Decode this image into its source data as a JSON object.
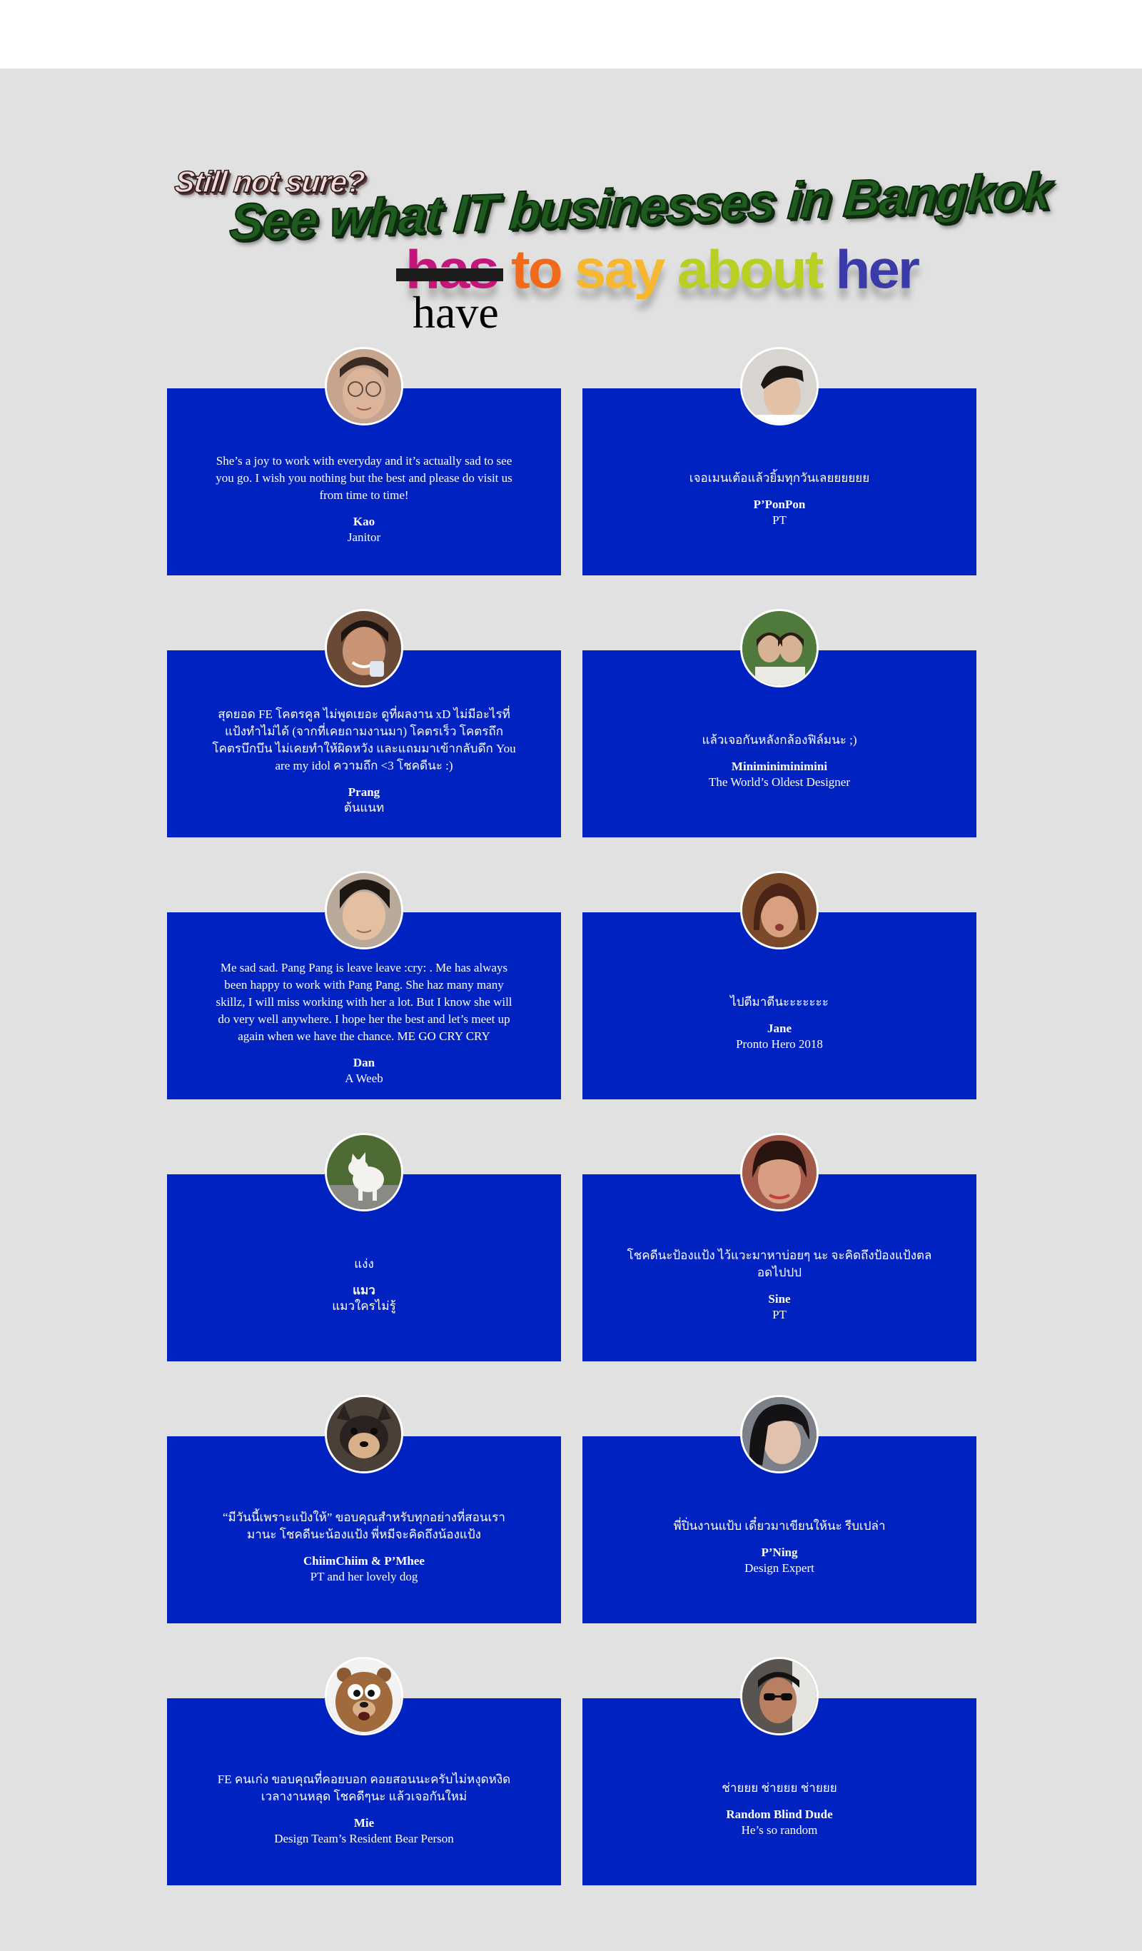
{
  "heading": {
    "still_not_sure": "Still not sure?",
    "see_what": "See what IT businesses in Bangkok",
    "has": "has",
    "to": "to",
    "say": "say",
    "about": "about",
    "her": "her",
    "have": "have"
  },
  "testimonials": [
    {
      "quote": "She’s a joy to work with everyday and it’s actually sad to see you go. I wish you nothing but the best and please do visit us from time to time!",
      "name": "Kao",
      "role": "Janitor",
      "avatar_icon": "person-photo-glasses"
    },
    {
      "quote": "เจอเมนเต้อแล้วยิ้มทุกวันเลยยยยยย",
      "name": "P’PonPon",
      "role": "PT",
      "avatar_icon": "person-photo"
    },
    {
      "quote": "สุดยอด FE โคตรคูล ไม่พูดเยอะ ดูที่ผลงาน xD ไม่มีอะไรที่แป้งทำไม่ได้ (จากที่เคยถามงานมา) โคตรเร็ว โคตรถึก โคตรบึกบึน ไม่เคยทำให้ผิดหวัง และแถมมาเข้ากลับดึก You are my idol ความถึก <3 โชคดีนะ :)",
      "name": "Prang",
      "role": "ต้นแนท",
      "avatar_icon": "person-photo-smiling"
    },
    {
      "quote": "แล้วเจอกันหลังกล้องฟิล์มนะ ;)",
      "name": "Miniminiminimini",
      "role": "The World’s Oldest Designer",
      "avatar_icon": "two-people-photo"
    },
    {
      "quote": "Me sad sad. Pang Pang is leave leave :cry: . Me has always been happy to work with Pang Pang. She haz many many skillz, I will miss working with her a lot. But I know she will do very well anywhere. I hope her the best and let’s meet up again when we have the chance. ME GO CRY CRY",
      "name": "Dan",
      "role": "A Weeb",
      "avatar_icon": "person-photo"
    },
    {
      "quote": "ไปตีมาตีนะะะะะะะ",
      "name": "Jane",
      "role": "Pronto Hero 2018",
      "avatar_icon": "person-photo"
    },
    {
      "quote": "แง่ง",
      "name": "แมว",
      "role": "แมวใครไม่รู้",
      "avatar_icon": "cat-photo"
    },
    {
      "quote": "โชคดีนะป้องแป้ง ไว้แวะมาหาบ่อยๆ นะ จะคิดถึงป้องแป้งตลอดไปปป",
      "name": "Sine",
      "role": "PT",
      "avatar_icon": "person-photo"
    },
    {
      "quote": "“มีวันนี้เพราะแป้งให้” ขอบคุณสำหรับทุกอย่างที่สอนเรามานะ โชคดีนะน้องแป้ง พี่หมีจะคิดถึงน้องแป้ง",
      "name": "ChiimChiim & P’Mhee",
      "role": "PT and her lovely dog",
      "avatar_icon": "dog-photo"
    },
    {
      "quote": "พี่ปิ่นงานแป้บ เดี๋ยวมาเขียนให้นะ รีบเปล่า",
      "name": "P’Ning",
      "role": "Design Expert",
      "avatar_icon": "person-photo"
    },
    {
      "quote": "FE คนเก่ง ขอบคุณที่คอยบอก คอยสอนนะครับไม่หงุดหงิด เวลางานหลุด โชคดีๆนะ แล้วเจอกันใหม่",
      "name": "Mie",
      "role": "Design Team’s Resident Bear Person",
      "avatar_icon": "cartoon-bear"
    },
    {
      "quote": "ช่ายยย ช่ายยย ช่ายยย",
      "name": "Random Blind Dude",
      "role": "He’s so random",
      "avatar_icon": "person-photo-sunglasses"
    }
  ],
  "colors": {
    "card_blue": "#0022c1",
    "section_bg": "#e1e1e1"
  }
}
